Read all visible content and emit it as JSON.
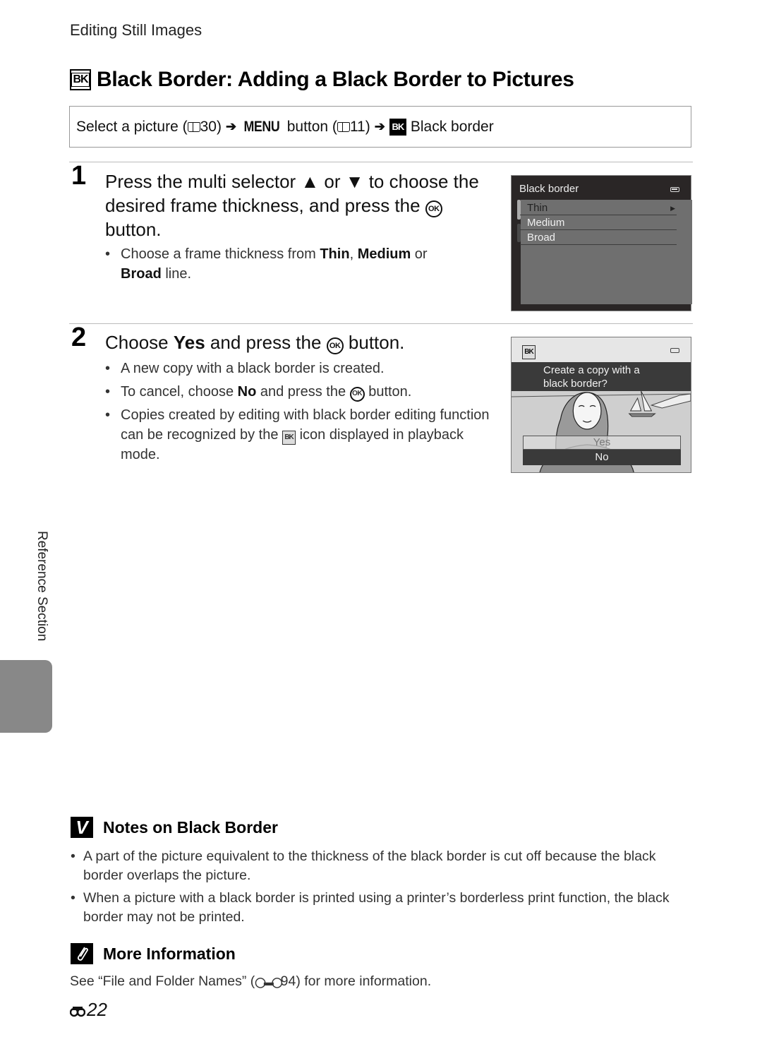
{
  "header": {
    "section": "Editing Still Images"
  },
  "title": {
    "icon": "black-border-icon",
    "icon_text": "BK",
    "text": "Black Border: Adding a Black Border to Pictures"
  },
  "path": {
    "part1": "Select a picture (",
    "ref1": "30",
    "part2": ")",
    "menu": "MENU",
    "part3": " button (",
    "ref2": "11",
    "part4": ")",
    "icon_text": "BK",
    "part5": "Black border",
    "arrow": "➔"
  },
  "step1": {
    "number": "1",
    "text_a": "Press the multi selector ",
    "up": "▲",
    "or": " or ",
    "down": "▼",
    "text_b": " to choose the desired frame thickness, and press the ",
    "ok": "OK",
    "text_c": " button.",
    "bullet": {
      "pre": "Choose a frame thickness from ",
      "opt1": "Thin",
      "sep1": ", ",
      "opt2": "Medium",
      "sep2": " or ",
      "opt3": "Broad",
      "post": " line."
    }
  },
  "screen1": {
    "title": "Black border",
    "options": [
      "Thin",
      "Medium",
      "Broad"
    ],
    "selected": "Thin"
  },
  "step2": {
    "number": "2",
    "pre": "Choose ",
    "yes": "Yes",
    "mid": " and press the ",
    "ok": "OK",
    "post": " button.",
    "bullets": {
      "b1": "A new copy with a black border is created.",
      "b2_pre": "To cancel, choose ",
      "b2_no": "No",
      "b2_mid": " and press the ",
      "b2_post": " button.",
      "b3_pre": "Copies created by editing with black border editing function can be recognized by the ",
      "b3_post": " icon displayed in playback mode."
    }
  },
  "screen2": {
    "icon_text": "BK",
    "prompt_line1": "Create a copy with a",
    "prompt_line2": "black border?",
    "yes": "Yes",
    "no": "No",
    "selected": "No"
  },
  "side": {
    "label": "Reference Section"
  },
  "notes": {
    "heading": "Notes on Black Border",
    "icon_glyph": "V",
    "items": [
      "A part of the picture equivalent to the thickness of the black border is cut off because the black border overlaps the picture.",
      "When a picture with a black border is printed using a printer’s borderless print function, the black border may not be printed."
    ]
  },
  "more": {
    "heading": "More Information",
    "pre": "See “File and Folder Names” (",
    "ref": "94",
    "post": ") for more information."
  },
  "page": {
    "number": "22"
  },
  "bullet_char": "•"
}
